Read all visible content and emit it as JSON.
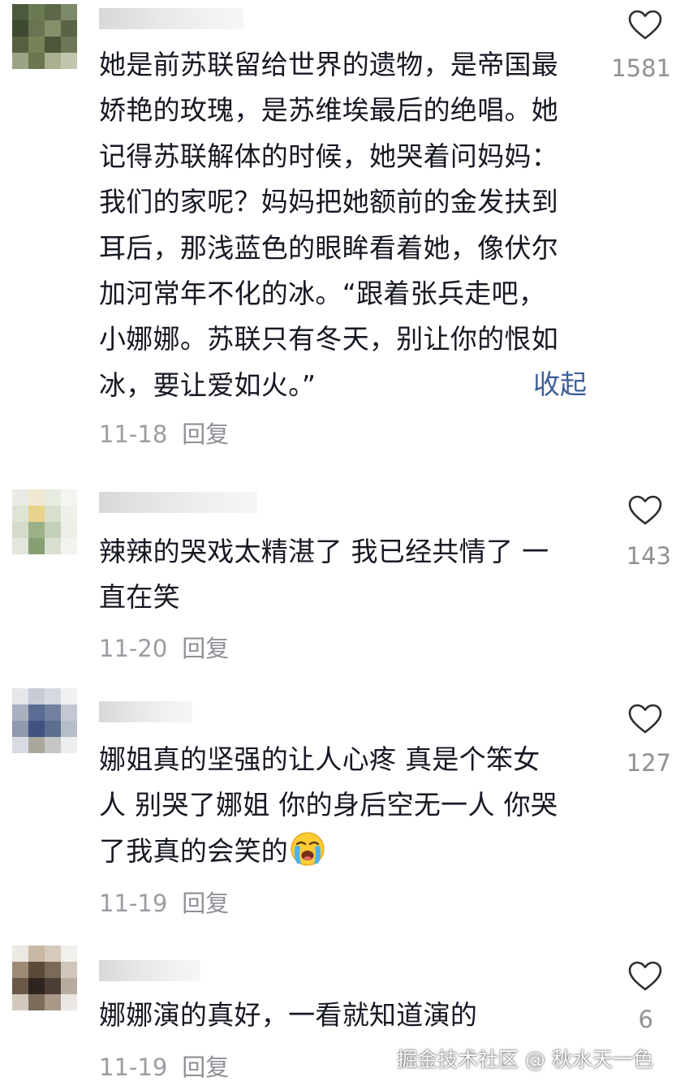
{
  "comments": [
    {
      "lines": [
        "她是前苏联留给世界的遗物，是帝国最",
        "娇艳的玫瑰，是苏维埃最后的绝唱。她",
        "记得苏联解体的时候，她哭着问妈妈：",
        "我们的家呢？妈妈把她额前的金发扶到",
        "耳后，那浅蓝色的眼眸看着她，像伏尔",
        "加河常年不化的冰。“跟着张兵走吧，",
        "小娜娜。苏联只有冬天，别让你的恨如",
        "冰，要让爱如火。”"
      ],
      "collapse_label": "收起",
      "date": "11-18",
      "reply_label": "回复",
      "like_count": "1581"
    },
    {
      "lines": [
        "辣辣的哭戏太精湛了 我已经共情了 一",
        "直在笑"
      ],
      "date": "11-20",
      "reply_label": "回复",
      "like_count": "143"
    },
    {
      "lines": [
        "娜姐真的坚强的让人心疼 真是个笨女",
        "人 别哭了娜姐 你的身后空无一人 你哭",
        "了我真的会笑的"
      ],
      "emoji": "loudly-crying-face-emoji",
      "date": "11-19",
      "reply_label": "回复",
      "like_count": "127"
    },
    {
      "lines": [
        "娜娜演的真好，一看就知道演的"
      ],
      "date": "11-19",
      "reply_label": "回复",
      "like_count": "6"
    }
  ],
  "watermark": "掘金技术社区 @ 秋水天一色",
  "icons": {
    "like": "heart-outline-icon"
  },
  "colors": {
    "text": "#161823",
    "meta": "#9b9da3",
    "link": "#3d5f9a"
  }
}
